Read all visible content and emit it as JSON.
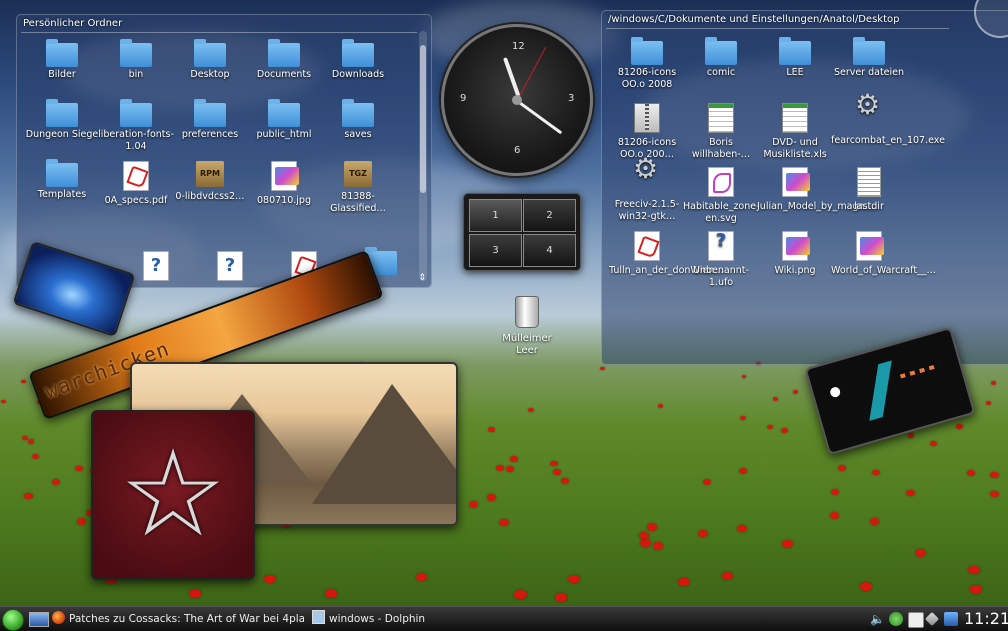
{
  "folder_left": {
    "title": "Persönlicher Ordner",
    "items": [
      {
        "label": "Bilder",
        "icon": "folder-icon"
      },
      {
        "label": "bin",
        "icon": "folder-icon"
      },
      {
        "label": "Desktop",
        "icon": "folder-icon"
      },
      {
        "label": "Documents",
        "icon": "folder-documents-icon"
      },
      {
        "label": "Downloads",
        "icon": "folder-icon"
      },
      {
        "label": "Dungeon Siege",
        "icon": "folder-icon"
      },
      {
        "label": "liberation-fonts-1.04",
        "icon": "folder-icon"
      },
      {
        "label": "preferences",
        "icon": "folder-icon"
      },
      {
        "label": "public_html",
        "icon": "folder-html-icon"
      },
      {
        "label": "saves",
        "icon": "folder-icon"
      },
      {
        "label": "Templates",
        "icon": "folder-icon"
      },
      {
        "label": "0A_specs.pdf",
        "icon": "pdf-file-icon"
      },
      {
        "label": "0-libdvdcss2…",
        "icon": "rpm-package-icon"
      },
      {
        "label": "080710.jpg",
        "icon": "image-file-icon"
      },
      {
        "label": "81388-Glassified…",
        "icon": "tgz-archive-icon"
      }
    ]
  },
  "folder_right": {
    "title": "/windows/C/Dokumente und Einstellungen/Anatol/Desktop",
    "items": [
      {
        "label": "81206-icons OO.o 2008",
        "icon": "folder-icon"
      },
      {
        "label": "comic",
        "icon": "folder-icon"
      },
      {
        "label": "LEE",
        "icon": "folder-icon"
      },
      {
        "label": "Server dateien",
        "icon": "folder-icon"
      },
      {
        "label": "81206-icons OO.o 200…",
        "icon": "zip-archive-icon"
      },
      {
        "label": "Boris willhaben-…",
        "icon": "spreadsheet-file-icon"
      },
      {
        "label": "DVD- und Musikliste.xls",
        "icon": "spreadsheet-file-icon"
      },
      {
        "label": "fearcombat_en_107.exe",
        "icon": "executable-gear-icon"
      },
      {
        "label": "Freeciv-2.1.5-win32-gtk…",
        "icon": "executable-gear-icon"
      },
      {
        "label": "Habitable_zone-en.svg",
        "icon": "svg-file-icon"
      },
      {
        "label": "Julian_Model_by_magn…",
        "icon": "image-file-icon"
      },
      {
        "label": "lastdir",
        "icon": "text-file-icon"
      },
      {
        "label": "Tulln_an_der_donWien…",
        "icon": "pdf-file-icon"
      },
      {
        "label": "Unbenannt-1.ufo",
        "icon": "unknown-file-icon"
      },
      {
        "label": "Wiki.png",
        "icon": "image-file-icon"
      },
      {
        "label": "World_of_Warcraft__…",
        "icon": "image-file-icon"
      }
    ]
  },
  "clock": {
    "numbers": [
      "12",
      "3",
      "6",
      "9"
    ],
    "hour": 11,
    "minute": 21
  },
  "pager": {
    "desktops": [
      "1",
      "2",
      "3",
      "4"
    ],
    "active": "1"
  },
  "trash": {
    "label": "Mülleimer Leer"
  },
  "photo_frames": {
    "banner_text": "warchicken"
  },
  "taskbar": {
    "tasks": [
      {
        "label": "Patches zu Cossacks: The Art of War bei 4players.de",
        "icon": "firefox-icon"
      },
      {
        "label": "windows - Dolphin",
        "icon": "dolphin-icon"
      }
    ],
    "time": "11:21"
  },
  "colors": {
    "panel": "#2c426e",
    "accent": "#3f8fd8",
    "taskbar": "#1a1a1a",
    "poppy": "#d4180d"
  }
}
